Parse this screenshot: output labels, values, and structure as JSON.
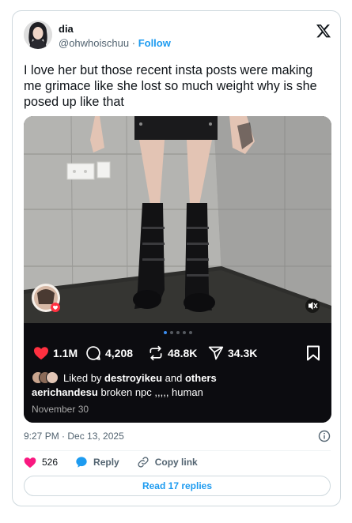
{
  "author": {
    "name": "dia",
    "handle": "@ohwhoischuu",
    "separator": "·",
    "follow_label": "Follow"
  },
  "tweet": {
    "text": "I love her but those recent insta posts were making me grimace like she lost so much weight why is she posed up like that",
    "timestamp": "9:27 PM · Dec 13, 2025"
  },
  "embedded_post": {
    "carousel": {
      "count": 5,
      "active": 0
    },
    "likes": "1.1M",
    "comments": "4,208",
    "reposts": "48.8K",
    "shares": "34.3K",
    "liked_by_prefix": "Liked by",
    "liked_by_user": "destroyikeu",
    "liked_by_and": "and",
    "liked_by_others": "others",
    "caption_user": "aerichandesu",
    "caption_text": "broken npc ,,,,, human",
    "date": "November 30"
  },
  "actions": {
    "like_count": "526",
    "reply_label": "Reply",
    "copy_link_label": "Copy link"
  },
  "read_replies_label": "Read 17 replies",
  "colors": {
    "accent": "#1d9bf0",
    "like_pink": "#f91880",
    "ig_heart": "#ff3040",
    "text_primary": "#0f1419",
    "text_secondary": "#536471",
    "border": "#cfd9de"
  },
  "icons": {
    "platform_logo": "x-logo-icon",
    "info": "info-icon",
    "like": "heart-icon",
    "reply": "speech-bubble-icon",
    "copy_link": "link-icon",
    "mute": "speaker-muted-icon",
    "bookmark": "bookmark-icon"
  }
}
